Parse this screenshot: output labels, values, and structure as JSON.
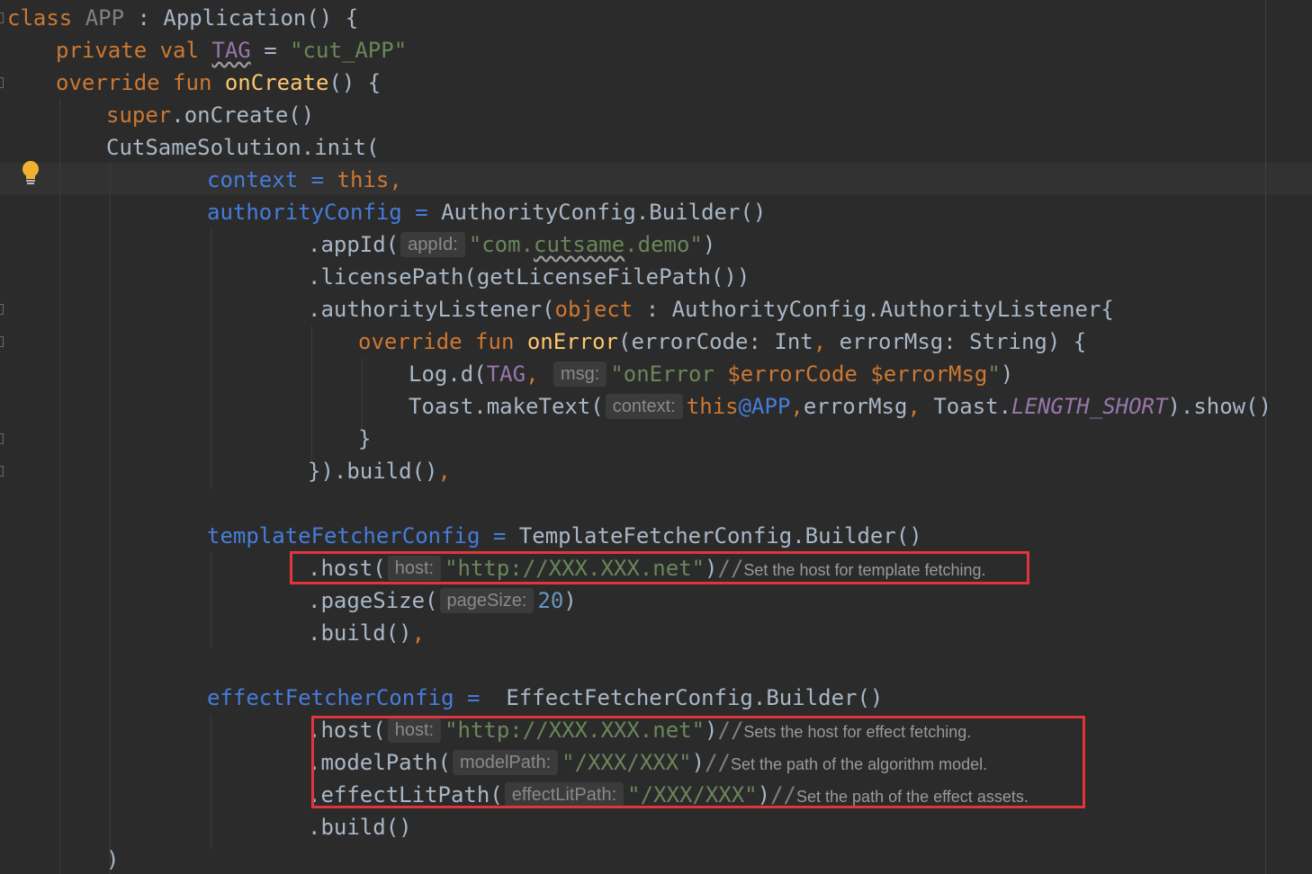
{
  "editor": {
    "colors": {
      "background": "#2b2b2b",
      "keyword": "#cc7832",
      "string": "#6a8759",
      "number": "#6897bb",
      "property": "#9876aa",
      "function": "#ffc66d",
      "highlight_box": "#e0363b"
    },
    "icons": [
      "intention-bulb-icon",
      "fold-marker-icon"
    ],
    "lines": {
      "l1": {
        "kw": "class",
        "name": "APP",
        "rest": " : Application() {"
      },
      "l2": {
        "kw1": "private val ",
        "tag": "TAG",
        "eq": " = ",
        "str": "\"cut_APP\""
      },
      "l3": {
        "kw": "override fun ",
        "fn": "onCreate",
        "rest": "() {"
      },
      "l4": {
        "kw": "super",
        "rest": ".onCreate()"
      },
      "l5": {
        "text": "CutSameSolution.init("
      },
      "l6": {
        "named": "context",
        "eq": " = ",
        "kw": "this,"
      },
      "l7": {
        "named": "authorityConfig",
        "eq": " = ",
        "rest": "AuthorityConfig.Builder()"
      },
      "l8": {
        "pre": ".appId(",
        "hint": "appId:",
        "str1": "\"com.",
        "str2": "cutsame",
        "str3": ".demo\"",
        "post": ")"
      },
      "l9": {
        "text": ".licensePath(getLicenseFilePath())"
      },
      "l10": {
        "pre": ".authorityListener(",
        "kw": "object",
        "rest": " : AuthorityConfig.AuthorityListener{"
      },
      "l11": {
        "kw1": "override fun ",
        "fn": "onError",
        "a": "(errorCode: Int",
        "comma": ",",
        "b": " errorMsg: String) {"
      },
      "l12": {
        "pre": "Log.d(",
        "tag": "TAG",
        "comma": ",",
        "hint": "msg:",
        "str1": "\"onError ",
        "v1": "$errorCode",
        "sp": " ",
        "v2": "$errorMsg",
        "str2": "\"",
        "post": ")"
      },
      "l13": {
        "pre": "Toast.makeText(",
        "hint": "context:",
        "kw": "this",
        "at": "@APP",
        "comma1": ",",
        "mid": "errorMsg",
        "comma2": ",",
        "mid2": " Toast.",
        "const": "LENGTH_SHORT",
        "post": ").show()"
      },
      "l14": {
        "text": "}"
      },
      "l15": {
        "text": "}).build()",
        "comma": ","
      },
      "l17": {
        "named": "templateFetcherConfig",
        "eq": " = ",
        "rest": "TemplateFetcherConfig.Builder()"
      },
      "l18": {
        "pre": ".host(",
        "hint": "host:",
        "str": "\"http://XXX.XXX.net\"",
        "post": ")",
        "slash": "//",
        "comment": "Set the host for template fetching."
      },
      "l19": {
        "pre": ".pageSize(",
        "hint": "pageSize:",
        "num": "20",
        "post": ")"
      },
      "l20": {
        "text": ".build()",
        "comma": ","
      },
      "l22": {
        "named": "effectFetcherConfig",
        "eq": " =  ",
        "rest": "EffectFetcherConfig.Builder()"
      },
      "l23": {
        "pre": ".host(",
        "hint": "host:",
        "str": "\"http://XXX.XXX.net\"",
        "post": ")",
        "slash": "//",
        "comment": "Sets the host for effect fetching."
      },
      "l24": {
        "pre": ".modelPath(",
        "hint": "modelPath:",
        "str": "\"/XXX/XXX\"",
        "post": ")",
        "slash": "//",
        "comment": "Set the path of the algorithm model."
      },
      "l25": {
        "pre": ".effectLitPath(",
        "hint": "effectLitPath:",
        "str": "\"/XXX/XXX\"",
        "post": ")",
        "slash": "//",
        "comment": "Set the path of the effect assets."
      },
      "l26": {
        "text": ".build()"
      },
      "l27": {
        "text": ")"
      }
    }
  }
}
